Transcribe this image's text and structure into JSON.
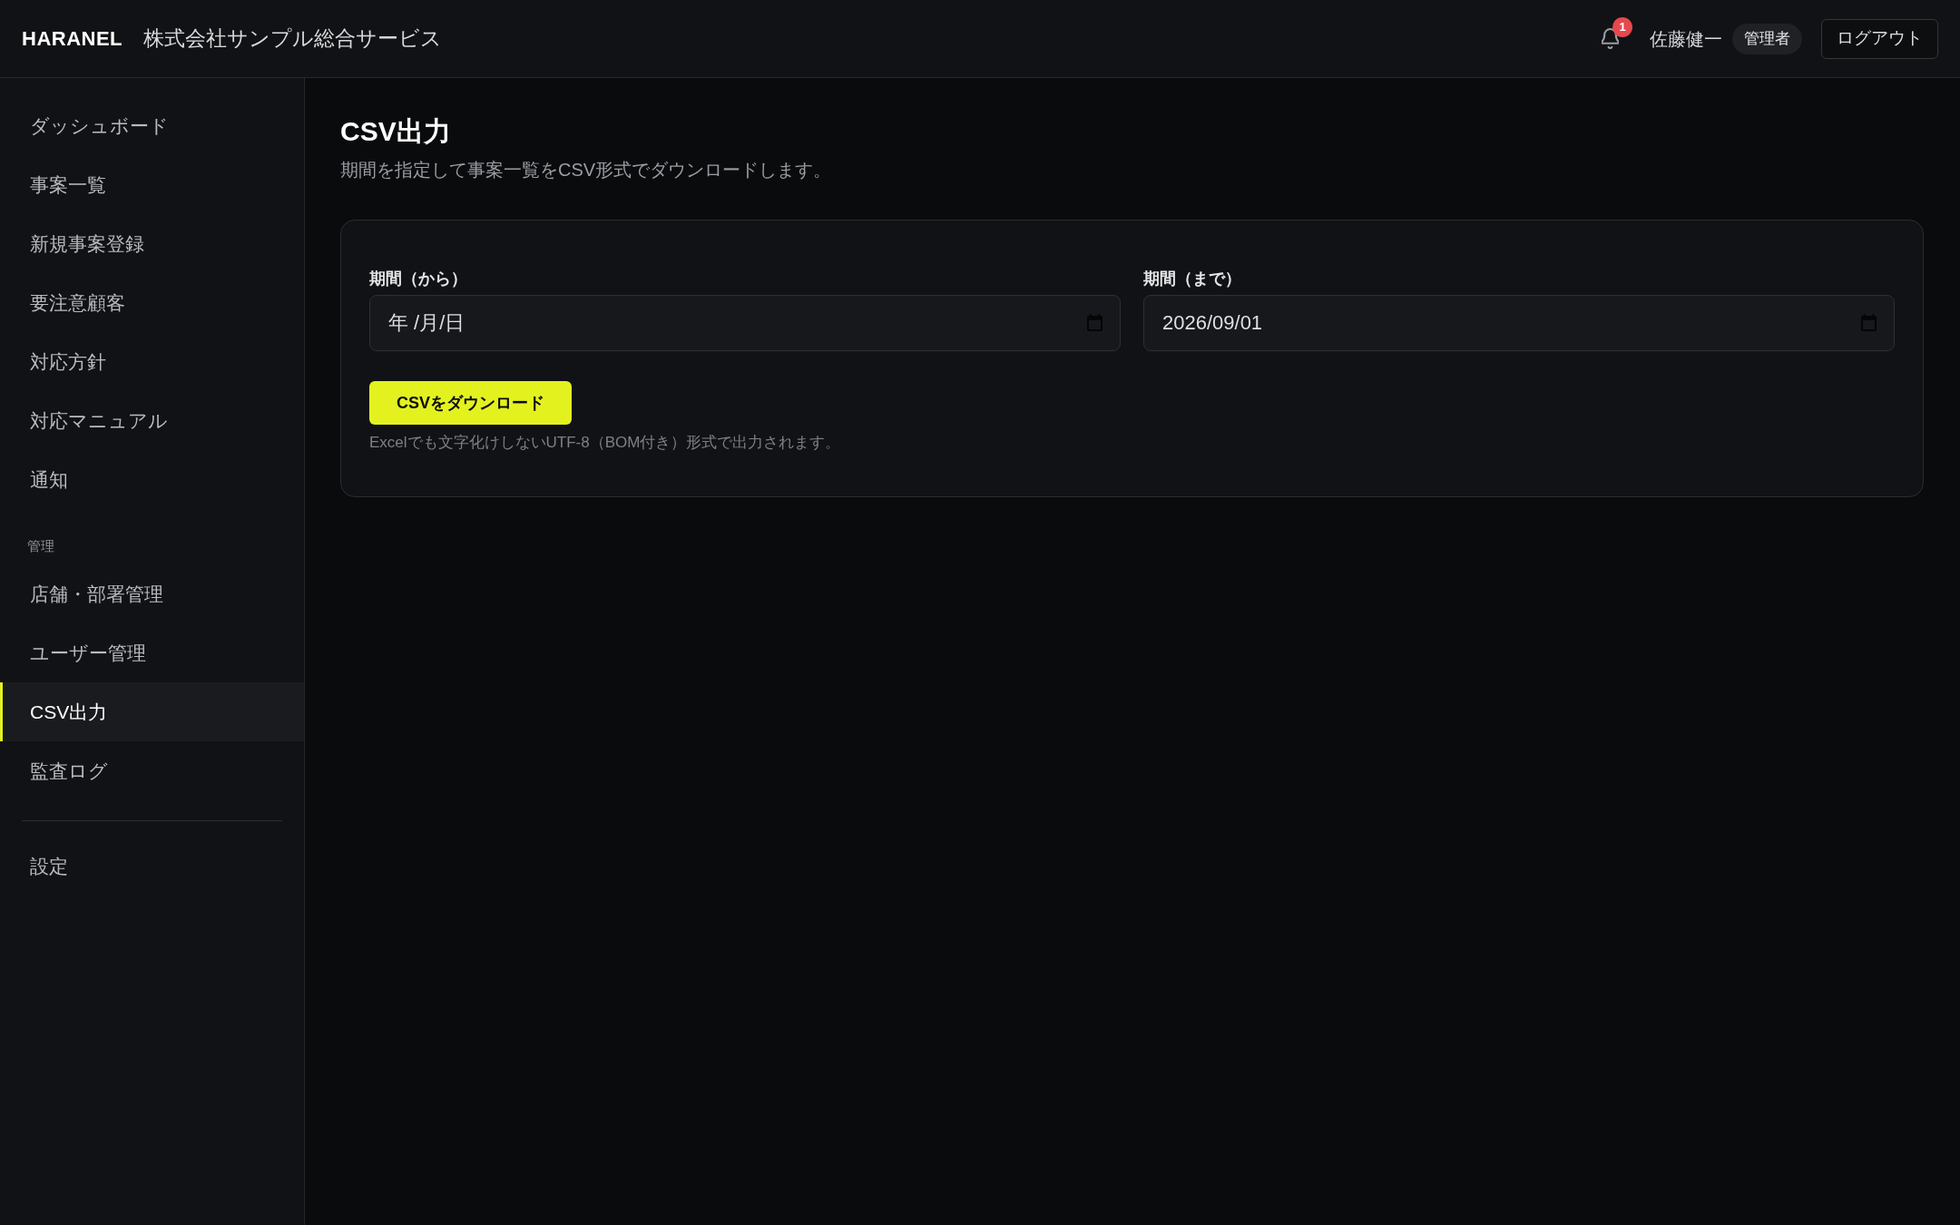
{
  "header": {
    "logo": "HARANEL",
    "company": "株式会社サンプル総合サービス",
    "notifications": {
      "count": "1"
    },
    "user": {
      "name": "佐藤健一",
      "role": "管理者"
    },
    "logout_button": "ログアウト"
  },
  "sidebar": {
    "items": [
      {
        "label": "ダッシュボード",
        "selected": false
      },
      {
        "label": "事案一覧",
        "selected": false
      },
      {
        "label": "新規事案登録",
        "selected": false
      },
      {
        "label": "要注意顧客",
        "selected": false
      },
      {
        "label": "対応方針",
        "selected": false
      },
      {
        "label": "対応マニュアル",
        "selected": false
      },
      {
        "label": "通知",
        "selected": false
      }
    ],
    "sections": [
      {
        "heading": "管理",
        "items": [
          {
            "label": "店舗・部署管理",
            "selected": false
          },
          {
            "label": "ユーザー管理",
            "selected": false
          },
          {
            "label": "CSV出力",
            "selected": true
          },
          {
            "label": "監査ログ",
            "selected": false
          }
        ]
      }
    ],
    "footer_items": [
      {
        "label": "設定",
        "selected": false
      }
    ]
  },
  "page": {
    "title": "CSV出力",
    "subtitle": "期間を指定して事案一覧をCSV形式でダウンロードします。"
  },
  "form": {
    "fields": [
      {
        "label": "期間（から）",
        "placeholder": "年 /月/日"
      },
      {
        "label": "期間（まで）",
        "value": "2026/09/01"
      }
    ],
    "submit_button": "CSVをダウンロード",
    "note": "Excelでも文字化けしないUTF-8（BOM付き）形式で出力されます。"
  }
}
